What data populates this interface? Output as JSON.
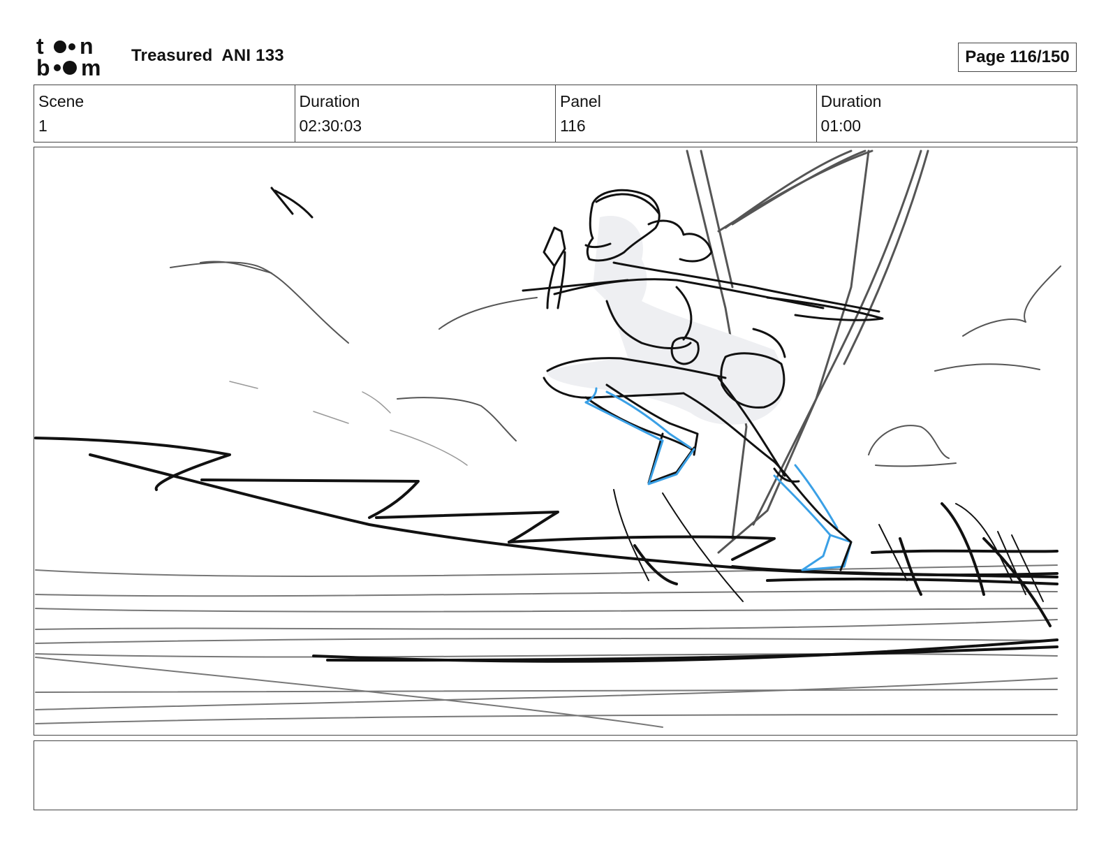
{
  "header": {
    "logo_line1": "toon",
    "logo_line2": "boom",
    "project_title": "Treasured  ANI 133",
    "page_label": "Page 116/150"
  },
  "info": [
    {
      "label": "Scene",
      "value": "1"
    },
    {
      "label": "Duration",
      "value": "02:30:03"
    },
    {
      "label": "Panel",
      "value": "116"
    },
    {
      "label": "Duration",
      "value": "01:00"
    }
  ],
  "notes": {
    "text": ""
  },
  "colors": {
    "sketch_black": "#111111",
    "sketch_gray": "#555555",
    "light_gray": "#999999",
    "blue_accent": "#3aa0e6",
    "figure_fill": "#eeeff2"
  }
}
